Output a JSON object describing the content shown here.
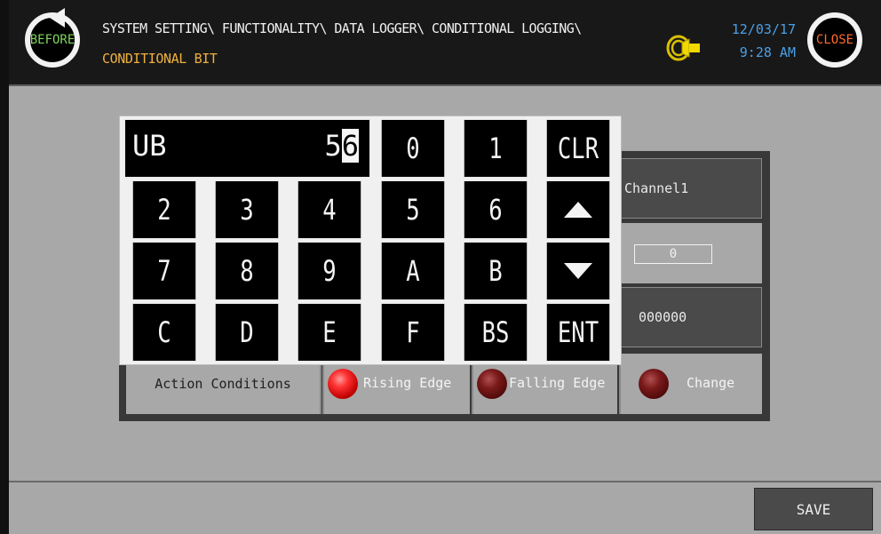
{
  "header": {
    "before_label": "BEFORE",
    "close_label": "CLOSE",
    "path_line1": "SYSTEM SETTING\\ FUNCTIONALITY\\ DATA LOGGER\\ CONDITIONAL LOGGING\\",
    "path_line2": "CONDITIONAL BIT",
    "date": "12/03/17",
    "time": "9:28 AM",
    "sound_icon": "speaker-icon"
  },
  "keypad": {
    "device_type": "UB",
    "value_fixed": "5",
    "value_cursor": "6",
    "keys": {
      "k0": "0",
      "k1": "1",
      "clr": "CLR",
      "k2": "2",
      "k3": "3",
      "k4": "4",
      "k5": "5",
      "k6": "6",
      "k7": "7",
      "k8": "8",
      "k9": "9",
      "kA": "A",
      "kB": "B",
      "kC": "C",
      "kD": "D",
      "kE": "E",
      "kF": "F",
      "bs": "BS",
      "ent": "ENT"
    },
    "up_icon": "arrow-up-icon",
    "down_icon": "arrow-down-icon"
  },
  "form": {
    "channel": "Channel1",
    "slot_value": "0",
    "address_value": "000000",
    "action_label": "Action Conditions",
    "options": [
      {
        "label": "Rising Edge",
        "selected": true
      },
      {
        "label": "Falling Edge",
        "selected": false
      },
      {
        "label": "Change",
        "selected": false
      }
    ]
  },
  "footer": {
    "save_label": "SAVE"
  },
  "colors": {
    "path_title": "#f0f0f0",
    "path_sub": "#f0b040",
    "datetime": "#4aa0e8",
    "before": "#7fd45a",
    "close": "#ff6a2a"
  }
}
